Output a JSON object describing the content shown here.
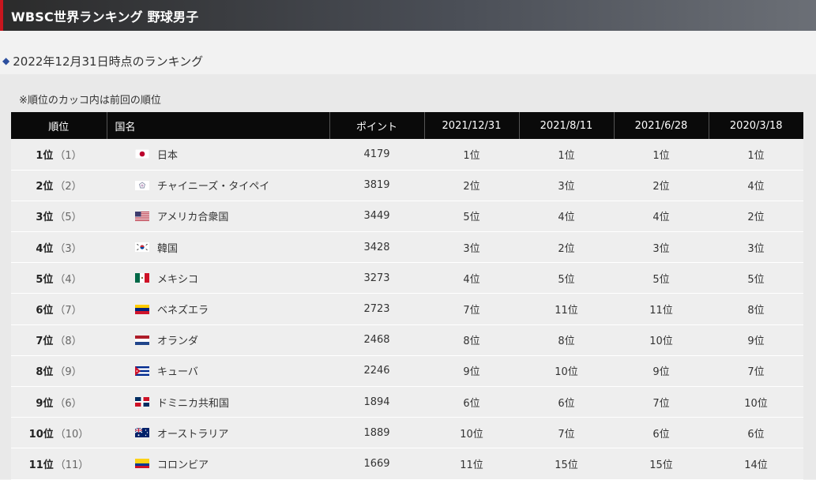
{
  "header": {
    "title": "WBSC世界ランキング 野球男子"
  },
  "subheading": {
    "marker": "◆",
    "text": "2022年12月31日時点のランキング"
  },
  "note": "※順位のカッコ内は前回の順位",
  "table": {
    "columns": [
      "順位",
      "国名",
      "ポイント",
      "2021/12/31",
      "2021/8/11",
      "2021/6/28",
      "2020/3/18"
    ],
    "rows": [
      {
        "rank": "1位",
        "prev": "（1）",
        "flag": "japan-flag",
        "country": "日本",
        "points": "4179",
        "r1": "1位",
        "r2": "1位",
        "r3": "1位",
        "r4": "1位"
      },
      {
        "rank": "2位",
        "prev": "（2）",
        "flag": "chinese-taipei-flag",
        "country": "チャイニーズ・タイペイ",
        "points": "3819",
        "r1": "2位",
        "r2": "3位",
        "r3": "2位",
        "r4": "4位"
      },
      {
        "rank": "3位",
        "prev": "（5）",
        "flag": "usa-flag",
        "country": "アメリカ合衆国",
        "points": "3449",
        "r1": "5位",
        "r2": "4位",
        "r3": "4位",
        "r4": "2位"
      },
      {
        "rank": "4位",
        "prev": "（3）",
        "flag": "korea-flag",
        "country": "韓国",
        "points": "3428",
        "r1": "3位",
        "r2": "2位",
        "r3": "3位",
        "r4": "3位"
      },
      {
        "rank": "5位",
        "prev": "（4）",
        "flag": "mexico-flag",
        "country": "メキシコ",
        "points": "3273",
        "r1": "4位",
        "r2": "5位",
        "r3": "5位",
        "r4": "5位"
      },
      {
        "rank": "6位",
        "prev": "（7）",
        "flag": "venezuela-flag",
        "country": "ベネズエラ",
        "points": "2723",
        "r1": "7位",
        "r2": "11位",
        "r3": "11位",
        "r4": "8位"
      },
      {
        "rank": "7位",
        "prev": "（8）",
        "flag": "netherlands-flag",
        "country": "オランダ",
        "points": "2468",
        "r1": "8位",
        "r2": "8位",
        "r3": "10位",
        "r4": "9位"
      },
      {
        "rank": "8位",
        "prev": "（9）",
        "flag": "cuba-flag",
        "country": "キューバ",
        "points": "2246",
        "r1": "9位",
        "r2": "10位",
        "r3": "9位",
        "r4": "7位"
      },
      {
        "rank": "9位",
        "prev": "（6）",
        "flag": "dominican-republic-flag",
        "country": "ドミニカ共和国",
        "points": "1894",
        "r1": "6位",
        "r2": "6位",
        "r3": "7位",
        "r4": "10位"
      },
      {
        "rank": "10位",
        "prev": "（10）",
        "flag": "australia-flag",
        "country": "オーストラリア",
        "points": "1889",
        "r1": "10位",
        "r2": "7位",
        "r3": "6位",
        "r4": "6位"
      },
      {
        "rank": "11位",
        "prev": "（11）",
        "flag": "colombia-flag",
        "country": "コロンビア",
        "points": "1669",
        "r1": "11位",
        "r2": "15位",
        "r3": "15位",
        "r4": "14位"
      }
    ]
  },
  "colors": {
    "header_accent": "#c8161e",
    "table_head": "#0a0a0a",
    "diamond": "#2c4f9e"
  }
}
